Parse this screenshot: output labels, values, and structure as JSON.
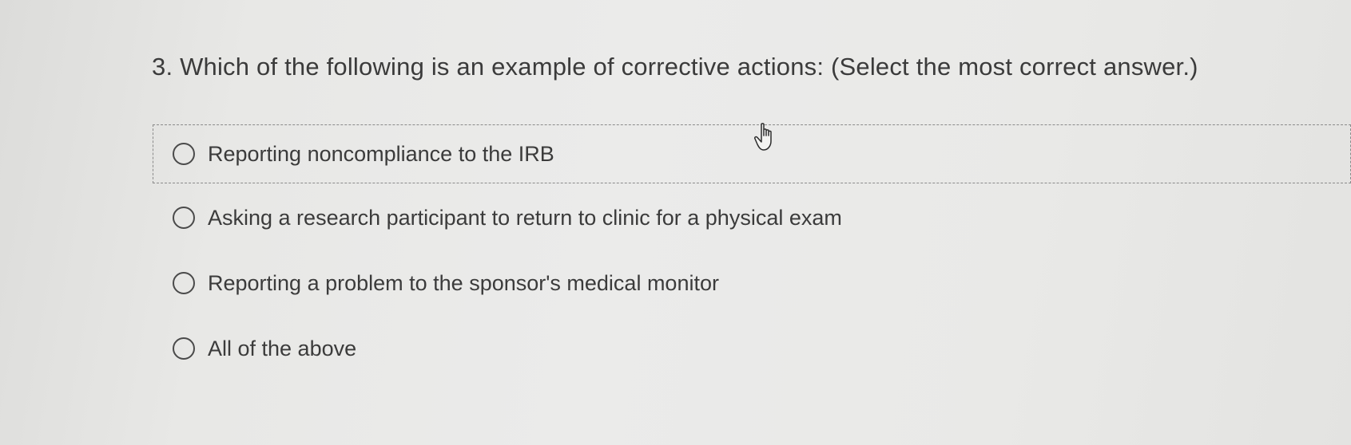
{
  "question": {
    "title": "3. Which of the following is an example of corrective actions: (Select the most correct answer.)",
    "selected": null,
    "options": [
      {
        "label": "Reporting noncompliance to the IRB",
        "focused": true
      },
      {
        "label": "Asking a research participant to return to clinic for a physical exam",
        "focused": false
      },
      {
        "label": "Reporting a problem to the sponsor's medical monitor",
        "focused": false
      },
      {
        "label": "All of the above",
        "focused": false
      }
    ]
  },
  "cursor": {
    "icon": "hand-pointer-icon"
  }
}
